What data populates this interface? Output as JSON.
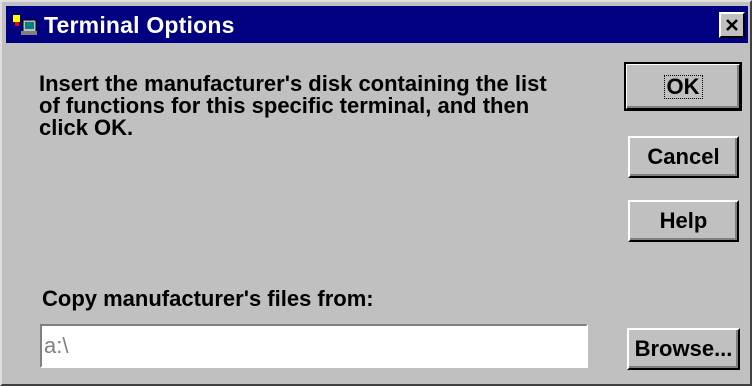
{
  "window": {
    "title": "Terminal Options",
    "title_icon": "terminal-app-icon",
    "close_icon": "close-icon"
  },
  "message": "Insert the manufacturer's disk containing the list\nof functions for this specific terminal, and then\nclick OK.",
  "buttons": {
    "ok": "OK",
    "cancel": "Cancel",
    "help": "Help",
    "browse": "Browse..."
  },
  "copy_from": {
    "label": "Copy manufacturer's files from:",
    "value": "a:\\"
  },
  "colors": {
    "titlebar": "#000080",
    "face": "#c0c0c0"
  }
}
